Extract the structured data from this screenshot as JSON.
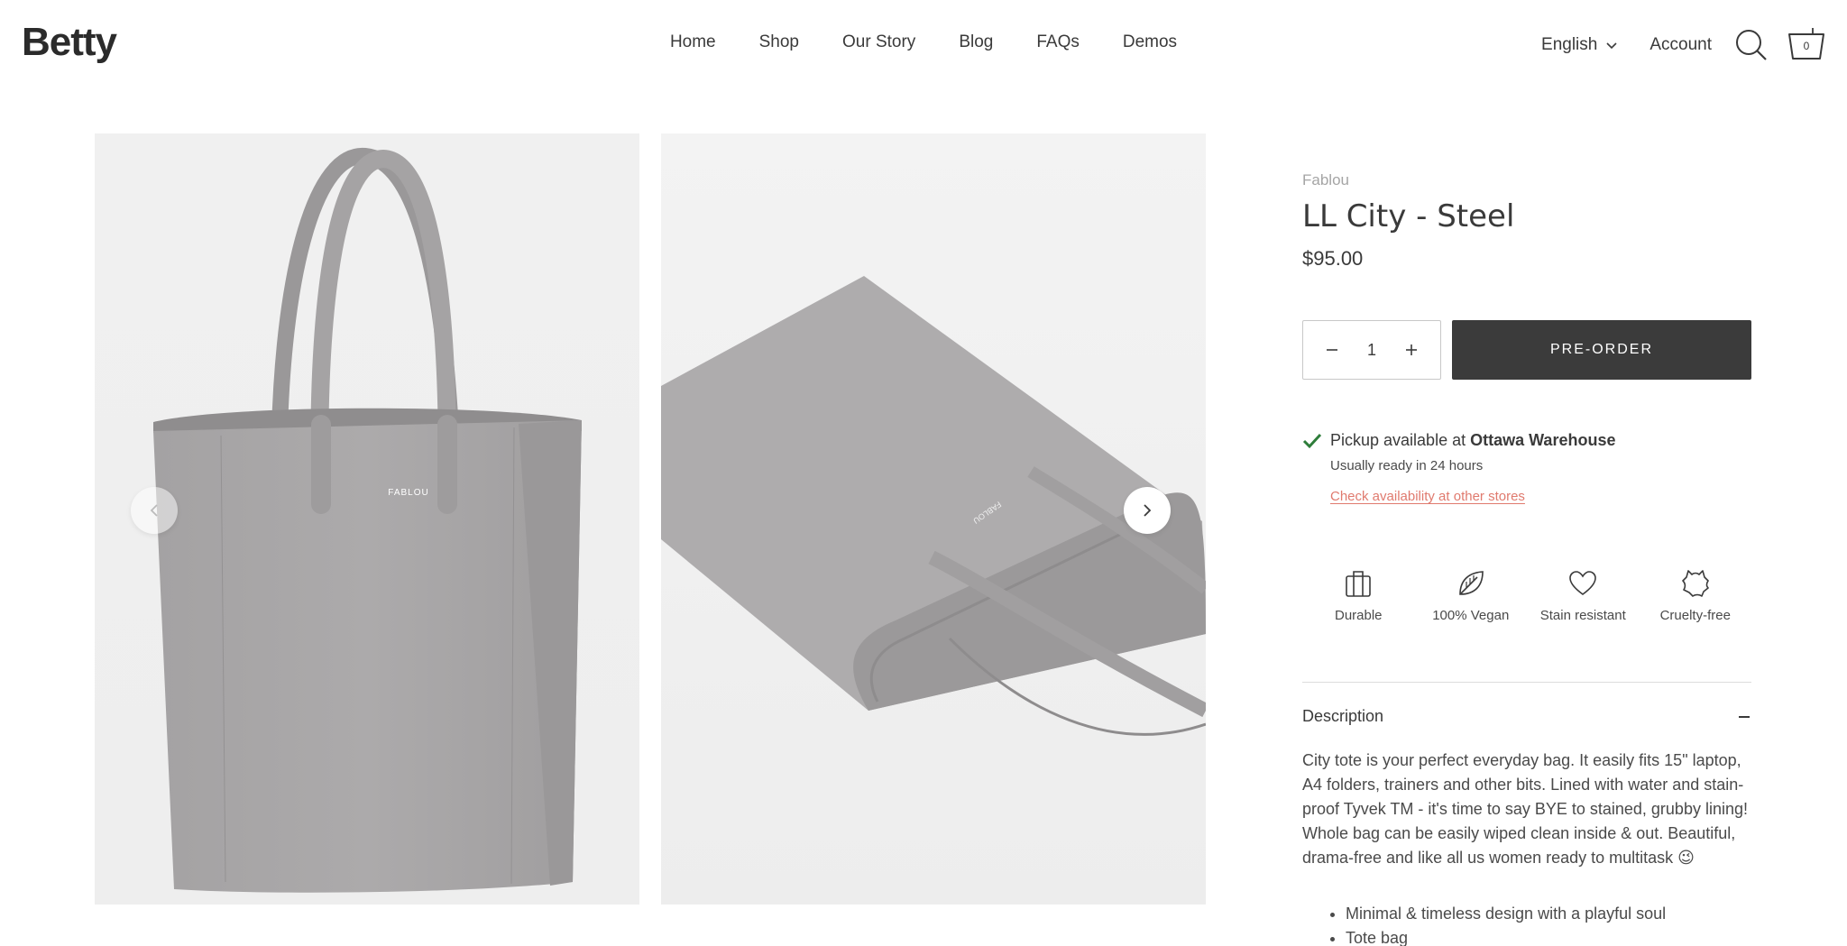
{
  "header": {
    "logo": "Betty",
    "nav": [
      "Home",
      "Shop",
      "Our Story",
      "Blog",
      "FAQs",
      "Demos"
    ],
    "language": "English",
    "account": "Account",
    "cart_count": "0"
  },
  "product": {
    "vendor": "Fablou",
    "title": "LL City - Steel",
    "price": "$95.00",
    "quantity": "1",
    "preorder_label": "PRE-ORDER",
    "pickup": {
      "prefix": "Pickup available at ",
      "location": "Ottawa Warehouse",
      "ready": "Usually ready in 24 hours",
      "link": "Check availability at other stores"
    },
    "features": [
      {
        "label": "Durable",
        "icon": "briefcase-icon"
      },
      {
        "label": "100% Vegan",
        "icon": "leaf-icon"
      },
      {
        "label": "Stain resistant",
        "icon": "heart-icon"
      },
      {
        "label": "Cruelty-free",
        "icon": "puzzle-icon"
      }
    ],
    "description": {
      "title": "Description",
      "body": "City tote is your perfect everyday bag. It easily fits 15\" laptop, A4 folders, trainers and other bits. Lined with water and stain-proof Tyvek TM - it's time to say BYE to stained, grubby lining! Whole bag can be easily wiped clean inside & out. Beautiful, drama-free and like all us women ready to multitask 😉",
      "bullets": [
        "Minimal & timeless design with a playful soul",
        "Tote bag"
      ]
    }
  },
  "gallery": {
    "brand_mark": "FABLOU"
  },
  "colors": {
    "button": "#3b3b3b",
    "link": "#e07a6e",
    "check": "#2e7d3a",
    "bag": "#a9a7a8"
  }
}
